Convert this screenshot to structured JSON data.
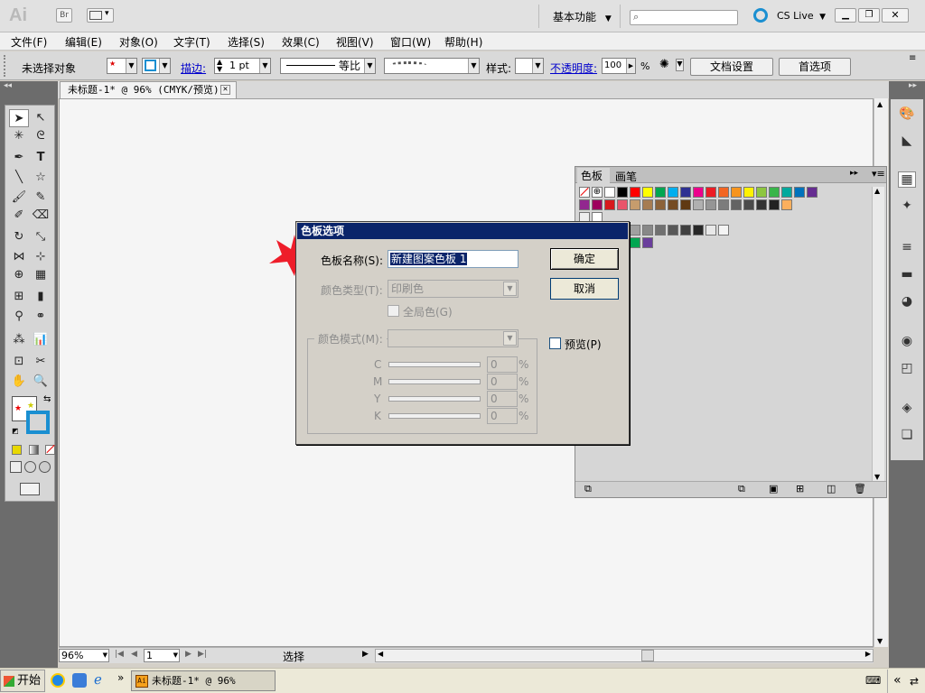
{
  "app": {
    "logo": "Ai",
    "bridge_badge": "Br",
    "workspace": "基本功能",
    "cs_live": "CS Live"
  },
  "menu": [
    "文件(F)",
    "编辑(E)",
    "对象(O)",
    "文字(T)",
    "选择(S)",
    "效果(C)",
    "视图(V)",
    "窗口(W)",
    "帮助(H)"
  ],
  "options": {
    "no_selection": "未选择对象",
    "stroke_label": "描边:",
    "stroke_weight": "1 pt",
    "stroke_profile": "等比",
    "style_label": "样式:",
    "opacity_label": "不透明度:",
    "opacity_value": "100",
    "opacity_unit": "%",
    "doc_setup": "文档设置",
    "preferences": "首选项"
  },
  "document": {
    "tab_title": "未标题-1* @ 96% (CMYK/预览)"
  },
  "status": {
    "zoom": "96%",
    "page": "1",
    "mode": "选择"
  },
  "swatches": {
    "tab_swatches": "色板",
    "tab_brushes": "画笔",
    "row1": [
      "#ffffff",
      "#000000",
      "#ff0000",
      "#ffff00",
      "#00a651",
      "#00aeef",
      "#2e3192",
      "#ec008c",
      "#ed1c24",
      "#f26522",
      "#f7941d",
      "#fff200",
      "#8dc63f",
      "#39b54a",
      "#00a99d",
      "#0072bc",
      "#662d91"
    ],
    "row2": [
      "#92278f",
      "#9e005d",
      "#d7191c",
      "#e9546b",
      "#c69c6d",
      "#a67c52",
      "#8c6239",
      "#754c24",
      "#603913",
      "#b0b0b0",
      "#959595",
      "#7c7c7c",
      "#636363",
      "#4a4a4a",
      "#333333",
      "#222222",
      "#fbaf5d"
    ],
    "grays": [
      "#d0d0d0",
      "#b8b8b8",
      "#a0a0a0",
      "#888888",
      "#707070",
      "#585858",
      "#404040",
      "#282828",
      "#e8e8e8",
      "#f4f4f4"
    ],
    "extra": [
      "#00a651",
      "#6a3e9c"
    ]
  },
  "dialog": {
    "title": "色板选项",
    "name_label": "色板名称(S):",
    "name_value": "新建图案色板 1",
    "type_label": "颜色类型(T):",
    "type_value": "印刷色",
    "global_label": "全局色(G)",
    "mode_label": "颜色模式(M):",
    "c_label": "C",
    "m_label": "M",
    "y_label": "Y",
    "k_label": "K",
    "c_value": "0",
    "m_value": "0",
    "y_value": "0",
    "k_value": "0",
    "pct": "%",
    "ok": "确定",
    "cancel": "取消",
    "preview_label": "预览(P)"
  },
  "taskbar": {
    "start": "开始",
    "task_title": "未标题-1* @ 96% (CM..."
  }
}
